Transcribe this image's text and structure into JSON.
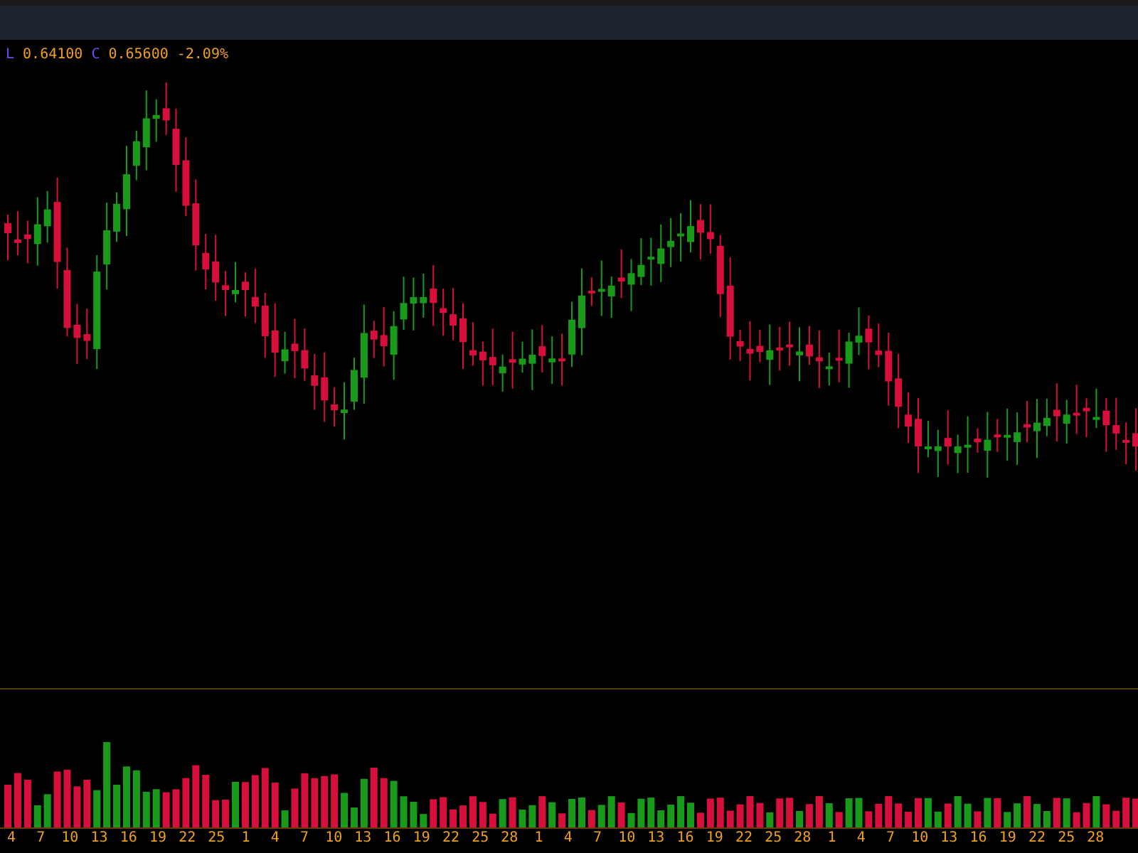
{
  "legend": [
    {
      "label": "L",
      "value": "0.64100"
    },
    {
      "label": "C",
      "value": "0.65600"
    }
  ],
  "change": "-2.09%",
  "x_axis": {
    "labels": [
      "4",
      "7",
      "10",
      "13",
      "16",
      "19",
      "22",
      "25",
      "1",
      "4",
      "7",
      "10",
      "13",
      "16",
      "19",
      "22",
      "25",
      "28",
      "1",
      "4",
      "7",
      "10",
      "13",
      "16",
      "19",
      "22",
      "25",
      "28",
      "1",
      "4",
      "7",
      "10",
      "13",
      "16",
      "19",
      "22",
      "25",
      "28"
    ]
  }
}
